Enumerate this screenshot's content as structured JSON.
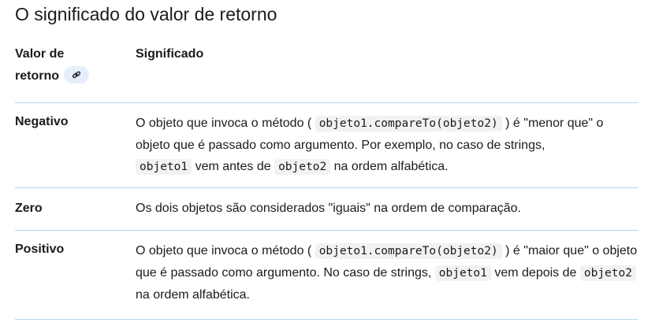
{
  "title": "O significado do valor de retorno",
  "table": {
    "header": {
      "col1_line1": "Valor de",
      "col1_line2": "retorno",
      "col2": "Significado",
      "link_icon": "link-icon"
    },
    "rows": [
      {
        "key": "Negativo",
        "p1": "O objeto que invoca o método (",
        "c1": "objeto1.compareTo(objeto2)",
        "p2": ") é \"menor que\" o objeto que é passado como argumento. Por exemplo, no caso de strings,",
        "c2": "objeto1",
        "p3": "vem antes de",
        "c3": "objeto2",
        "p4": "na ordem alfabética."
      },
      {
        "key": "Zero",
        "text": "Os dois objetos são considerados \"iguais\" na ordem de comparação."
      },
      {
        "key": "Positivo",
        "p1": "O objeto que invoca o método (",
        "c1": "objeto1.compareTo(objeto2)",
        "p2": ") é \"maior que\" o objeto que é passado como argumento. No caso de strings,",
        "c2": "objeto1",
        "p3": "vem depois de",
        "c3": "objeto2",
        "p4": "na ordem alfabética."
      }
    ]
  }
}
